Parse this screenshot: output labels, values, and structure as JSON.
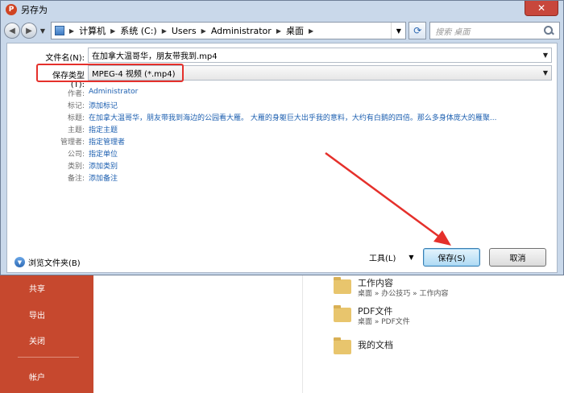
{
  "window": {
    "title": "另存为",
    "app_icon": "P"
  },
  "navigation": {
    "breadcrumb": [
      "计算机",
      "系统 (C:)",
      "Users",
      "Administrator",
      "桌面"
    ],
    "search_placeholder": "搜索 桌面"
  },
  "form": {
    "filename_label": "文件名(N):",
    "filename_value": "在加拿大温哥华，朋友带我到.mp4",
    "filetype_label": "保存类型(T):",
    "filetype_value": "MPEG-4 视频 (*.mp4)"
  },
  "metadata": [
    {
      "label": "作者:",
      "value": "Administrator"
    },
    {
      "label": "标记:",
      "value": "添加标记"
    },
    {
      "label": "标题:",
      "value": "在加拿大温哥华，朋友带我到海边的公园看大雁。        大雁的身躯巨大出乎我的意料，大约有白鹅的四倍。那么多身体庞大的雁聚..."
    },
    {
      "label": "主题:",
      "value": "指定主题"
    },
    {
      "label": "管理者:",
      "value": "指定管理者"
    },
    {
      "label": "公司:",
      "value": "指定单位"
    },
    {
      "label": "类别:",
      "value": "添加类别"
    },
    {
      "label": "备注:",
      "value": "添加备注"
    }
  ],
  "footer": {
    "browse_label": "浏览文件夹(B)",
    "tools_label": "工具(L)",
    "save_label": "保存(S)",
    "cancel_label": "取消"
  },
  "background": {
    "nav": [
      "共享",
      "导出",
      "关闭",
      "帐户"
    ],
    "recent": [
      {
        "name": "工作内容",
        "path": "桌面 » 办公技巧 » 工作内容"
      },
      {
        "name": "PDF文件",
        "path": "桌面 » PDF文件"
      },
      {
        "name": "我的文档",
        "path": ""
      }
    ]
  },
  "colors": {
    "highlight": "#e5302b",
    "arrow": "#e5302b",
    "link": "#1c5fb0",
    "backstage": "#c6482e"
  }
}
